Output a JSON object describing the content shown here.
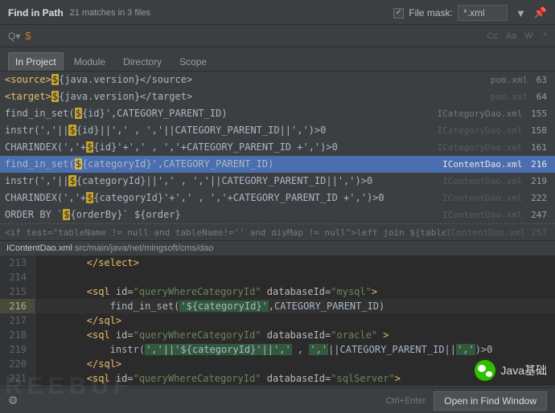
{
  "header": {
    "title": "Find in Path",
    "subtitle": "21 matches in 3 files",
    "file_mask_label": "File mask:",
    "file_mask_value": "*.xml"
  },
  "search": {
    "query": "$"
  },
  "options": {
    "cc": "Cc",
    "aa": "Aa",
    "w": "W",
    "regex": ".*"
  },
  "tabs": [
    {
      "label": "In Project",
      "active": true
    },
    {
      "label": "Module",
      "active": false
    },
    {
      "label": "Directory",
      "active": false
    },
    {
      "label": "Scope",
      "active": false
    }
  ],
  "results": [
    {
      "pre": "<source>",
      "hl": "$",
      "post": "{java.version}</source>",
      "file": "pom.xml",
      "line": "63",
      "faded": false
    },
    {
      "pre": "<target>",
      "hl": "$",
      "post": "{java.version}</target>",
      "file": "pom.xml",
      "line": "64",
      "faded": true
    },
    {
      "pre": "find_in_set(",
      "hl": "$",
      "post": "{id}',CATEGORY_PARENT_ID)",
      "file": "ICategoryDao.xml",
      "line": "155",
      "faded": false
    },
    {
      "pre": "instr(','||",
      "hl": "$",
      "post": "{id}||',' , ','||CATEGORY_PARENT_ID||',')>0",
      "file": "ICategoryDao.xml",
      "line": "158",
      "faded": true
    },
    {
      "pre": "CHARINDEX(','+",
      "hl": "$",
      "post": "{id}'+',' , ','+CATEGORY_PARENT_ID +',')>0",
      "file": "ICategoryDao.xml",
      "line": "161",
      "faded": true
    },
    {
      "pre": "find_in_set(",
      "hl": "$",
      "post": "{categoryId}',CATEGORY_PARENT_ID)",
      "file": "IContentDao.xml",
      "line": "216",
      "faded": false,
      "selected": true
    },
    {
      "pre": "instr(','||",
      "hl": "$",
      "post": "{categoryId}||',' , ','||CATEGORY_PARENT_ID||',')>0",
      "file": "IContentDao.xml",
      "line": "219",
      "faded": true
    },
    {
      "pre": "CHARINDEX(','+",
      "hl": "$",
      "post": "{categoryId}'+',' , ','+CATEGORY_PARENT_ID +',')>0",
      "file": "IContentDao.xml",
      "line": "222",
      "faded": true
    },
    {
      "pre": "ORDER BY `",
      "hl": "$",
      "post": "{orderBy}` ${order}",
      "file": "IContentDao.xml",
      "line": "247",
      "faded": true
    }
  ],
  "cut_row": {
    "text": "<if test=\"tableName != null and tableName!=''  and diyMap != null\">left join ${tableName} d on d.link_id=a.id",
    "file": "IContentDao.xml",
    "line": "257"
  },
  "path": {
    "file": "IContentDao.xml",
    "rest": "src/main/java/net/mingsoft/cms/dao"
  },
  "editor": [
    {
      "n": "213",
      "indent": 8,
      "segs": [
        {
          "t": "tag",
          "v": "</select>"
        }
      ]
    },
    {
      "n": "214",
      "indent": 0,
      "segs": []
    },
    {
      "n": "215",
      "indent": 8,
      "segs": [
        {
          "t": "tag",
          "v": "<sql "
        },
        {
          "t": "attr",
          "v": "id="
        },
        {
          "t": "str",
          "v": "\"queryWhereCategoryId\""
        },
        {
          "t": "attr",
          "v": " databaseId="
        },
        {
          "t": "str",
          "v": "\"mysql\""
        },
        {
          "t": "tag",
          "v": ">"
        }
      ]
    },
    {
      "n": "216",
      "indent": 12,
      "hi": true,
      "segs": [
        {
          "t": "plain",
          "v": "find_in_set("
        },
        {
          "t": "match",
          "v": "'${categoryId}'"
        },
        {
          "t": "plain",
          "v": ",CATEGORY_PARENT_ID)"
        }
      ]
    },
    {
      "n": "217",
      "indent": 8,
      "segs": [
        {
          "t": "tag",
          "v": "</sql>"
        }
      ]
    },
    {
      "n": "218",
      "indent": 8,
      "segs": [
        {
          "t": "tag",
          "v": "<sql "
        },
        {
          "t": "attr",
          "v": "id="
        },
        {
          "t": "str",
          "v": "\"queryWhereCategoryId\""
        },
        {
          "t": "attr",
          "v": " databaseId="
        },
        {
          "t": "str",
          "v": "\"oracle\""
        },
        {
          "t": "tag",
          "v": " >"
        }
      ]
    },
    {
      "n": "219",
      "indent": 12,
      "segs": [
        {
          "t": "plain",
          "v": "instr("
        },
        {
          "t": "match",
          "v": "','||'${categoryId}'||','"
        },
        {
          "t": "plain",
          "v": " , "
        },
        {
          "t": "match",
          "v": "','"
        },
        {
          "t": "plain",
          "v": "||CATEGORY_PARENT_ID||"
        },
        {
          "t": "match",
          "v": "','"
        },
        {
          "t": "plain",
          "v": ")>0"
        }
      ]
    },
    {
      "n": "220",
      "indent": 8,
      "segs": [
        {
          "t": "tag",
          "v": "</sql>"
        }
      ]
    },
    {
      "n": "221",
      "indent": 8,
      "segs": [
        {
          "t": "tag",
          "v": "<sql "
        },
        {
          "t": "attr",
          "v": "id="
        },
        {
          "t": "str",
          "v": "\"queryWhereCategoryId\""
        },
        {
          "t": "attr",
          "v": " databaseId="
        },
        {
          "t": "str",
          "v": "\"sqlServer\""
        },
        {
          "t": "tag",
          "v": ">"
        }
      ]
    }
  ],
  "footer": {
    "hint": "Ctrl+Enter",
    "button": "Open in Find Window"
  },
  "watermark": "REEBUF",
  "wechat": "Java基础"
}
